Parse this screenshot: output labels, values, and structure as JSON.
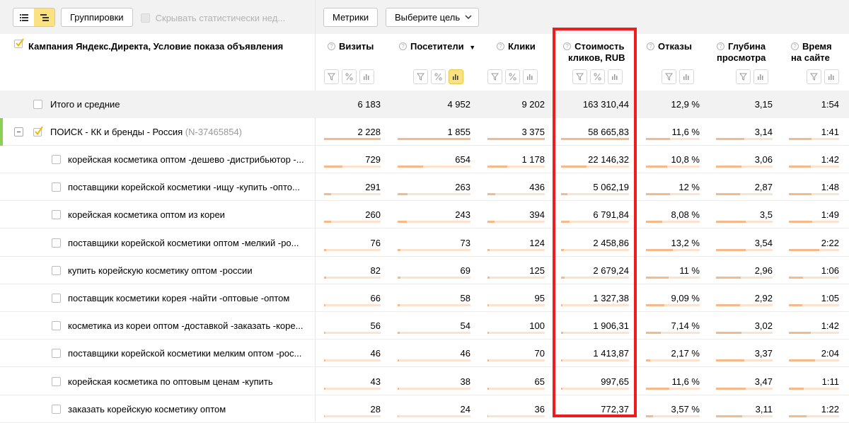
{
  "toolbar": {
    "groupings_label": "Группировки",
    "hide_insignificant_label": "Скрывать статистически нед...",
    "metrics_label": "Метрики",
    "goal_select_label": "Выберите цель"
  },
  "header": {
    "main_column": "Кампания Яндекс.Директа, Условие показа объявления",
    "columns": {
      "visits": "Визиты",
      "visitors": "Посетители",
      "sort_arrow": "▼",
      "clicks": "Клики",
      "cost_line1": "Стоимость",
      "cost_line2": "кликов, RUB",
      "bounce": "Отказы",
      "depth_line1": "Глубина",
      "depth_line2": "просмотра",
      "time_line1": "Время",
      "time_line2": "на сайте"
    }
  },
  "totals": {
    "label": "Итого и средние",
    "visits": "6 183",
    "visitors": "4 952",
    "clicks": "9 202",
    "cost": "163 310,44",
    "bounce": "12,9 %",
    "depth": "3,15",
    "time": "1:54"
  },
  "campaign": {
    "label": "ПОИСК - КК и бренды - Россия",
    "code": "(N-37465854)",
    "visits": "2 228",
    "visitors": "1 855",
    "clicks": "3 375",
    "cost": "58 665,83",
    "bounce": "11,6 %",
    "depth": "3,14",
    "time": "1:41",
    "bars": {
      "visits": 1,
      "visitors": 1,
      "clicks": 1,
      "cost": 1,
      "bounce": 0.45,
      "depth": 0.5,
      "time": 0.45
    }
  },
  "rows": [
    {
      "label": "корейская косметика оптом -дешево -дистрибьютор -...",
      "visits": "729",
      "visitors": "654",
      "clicks": "1 178",
      "cost": "22 146,32",
      "bounce": "10,8 %",
      "depth": "3,06",
      "time": "1:42",
      "bars": {
        "visits": 0.33,
        "visitors": 0.35,
        "clicks": 0.35,
        "cost": 0.38,
        "bounce": 0.4,
        "depth": 0.45,
        "time": 0.43
      }
    },
    {
      "label": "поставщики корейской косметики -ищу -купить -опто...",
      "visits": "291",
      "visitors": "263",
      "clicks": "436",
      "cost": "5 062,19",
      "bounce": "12 %",
      "depth": "2,87",
      "time": "1:48",
      "bars": {
        "visits": 0.13,
        "visitors": 0.14,
        "clicks": 0.13,
        "cost": 0.09,
        "bounce": 0.45,
        "depth": 0.43,
        "time": 0.45
      }
    },
    {
      "label": "корейская косметика оптом из кореи",
      "visits": "260",
      "visitors": "243",
      "clicks": "394",
      "cost": "6 791,84",
      "bounce": "8,08 %",
      "depth": "3,5",
      "time": "1:49",
      "bars": {
        "visits": 0.12,
        "visitors": 0.13,
        "clicks": 0.12,
        "cost": 0.12,
        "bounce": 0.3,
        "depth": 0.52,
        "time": 0.46
      }
    },
    {
      "label": "поставщики корейской косметики оптом -мелкий -ро...",
      "visits": "76",
      "visitors": "73",
      "clicks": "124",
      "cost": "2 458,86",
      "bounce": "13,2 %",
      "depth": "3,54",
      "time": "2:22",
      "bars": {
        "visits": 0.04,
        "visitors": 0.04,
        "clicks": 0.04,
        "cost": 0.04,
        "bounce": 0.5,
        "depth": 0.53,
        "time": 0.6
      }
    },
    {
      "label": "купить корейскую косметику оптом -россии",
      "visits": "82",
      "visitors": "69",
      "clicks": "125",
      "cost": "2 679,24",
      "bounce": "11 %",
      "depth": "2,96",
      "time": "1:06",
      "bars": {
        "visits": 0.04,
        "visitors": 0.04,
        "clicks": 0.04,
        "cost": 0.05,
        "bounce": 0.42,
        "depth": 0.44,
        "time": 0.28
      }
    },
    {
      "label": "поставщик косметики корея -найти -оптовые -оптом",
      "visits": "66",
      "visitors": "58",
      "clicks": "95",
      "cost": "1 327,38",
      "bounce": "9,09 %",
      "depth": "2,92",
      "time": "1:05",
      "bars": {
        "visits": 0.03,
        "visitors": 0.03,
        "clicks": 0.03,
        "cost": 0.02,
        "bounce": 0.34,
        "depth": 0.43,
        "time": 0.27
      }
    },
    {
      "label": "косметика из кореи оптом -доставкой -заказать -коре...",
      "visits": "56",
      "visitors": "54",
      "clicks": "100",
      "cost": "1 906,31",
      "bounce": "7,14 %",
      "depth": "3,02",
      "time": "1:42",
      "bars": {
        "visits": 0.03,
        "visitors": 0.03,
        "clicks": 0.03,
        "cost": 0.03,
        "bounce": 0.27,
        "depth": 0.45,
        "time": 0.43
      }
    },
    {
      "label": "поставщики корейской косметики мелким оптом -рос...",
      "visits": "46",
      "visitors": "46",
      "clicks": "70",
      "cost": "1 413,87",
      "bounce": "2,17 %",
      "depth": "3,37",
      "time": "2:04",
      "bars": {
        "visits": 0.02,
        "visitors": 0.02,
        "clicks": 0.02,
        "cost": 0.02,
        "bounce": 0.08,
        "depth": 0.5,
        "time": 0.52
      }
    },
    {
      "label": "корейская косметика по оптовым ценам -купить",
      "visits": "43",
      "visitors": "38",
      "clicks": "65",
      "cost": "997,65",
      "bounce": "11,6 %",
      "depth": "3,47",
      "time": "1:11",
      "bars": {
        "visits": 0.02,
        "visitors": 0.02,
        "clicks": 0.02,
        "cost": 0.02,
        "bounce": 0.44,
        "depth": 0.52,
        "time": 0.3
      }
    },
    {
      "label": "заказать корейскую косметику оптом",
      "visits": "28",
      "visitors": "24",
      "clicks": "36",
      "cost": "772,37",
      "bounce": "3,57 %",
      "depth": "3,11",
      "time": "1:22",
      "bars": {
        "visits": 0.01,
        "visitors": 0.01,
        "clicks": 0.01,
        "cost": 0.01,
        "bounce": 0.13,
        "depth": 0.46,
        "time": 0.35
      }
    }
  ],
  "colors": {
    "accent_yellow": "#fae182",
    "highlight_red": "#ee1c1c",
    "bar_fill": "#f5b98a",
    "bar_track": "#fbe3cf",
    "campaign_marker": "#8bcf53",
    "muted_text": "#999999"
  }
}
